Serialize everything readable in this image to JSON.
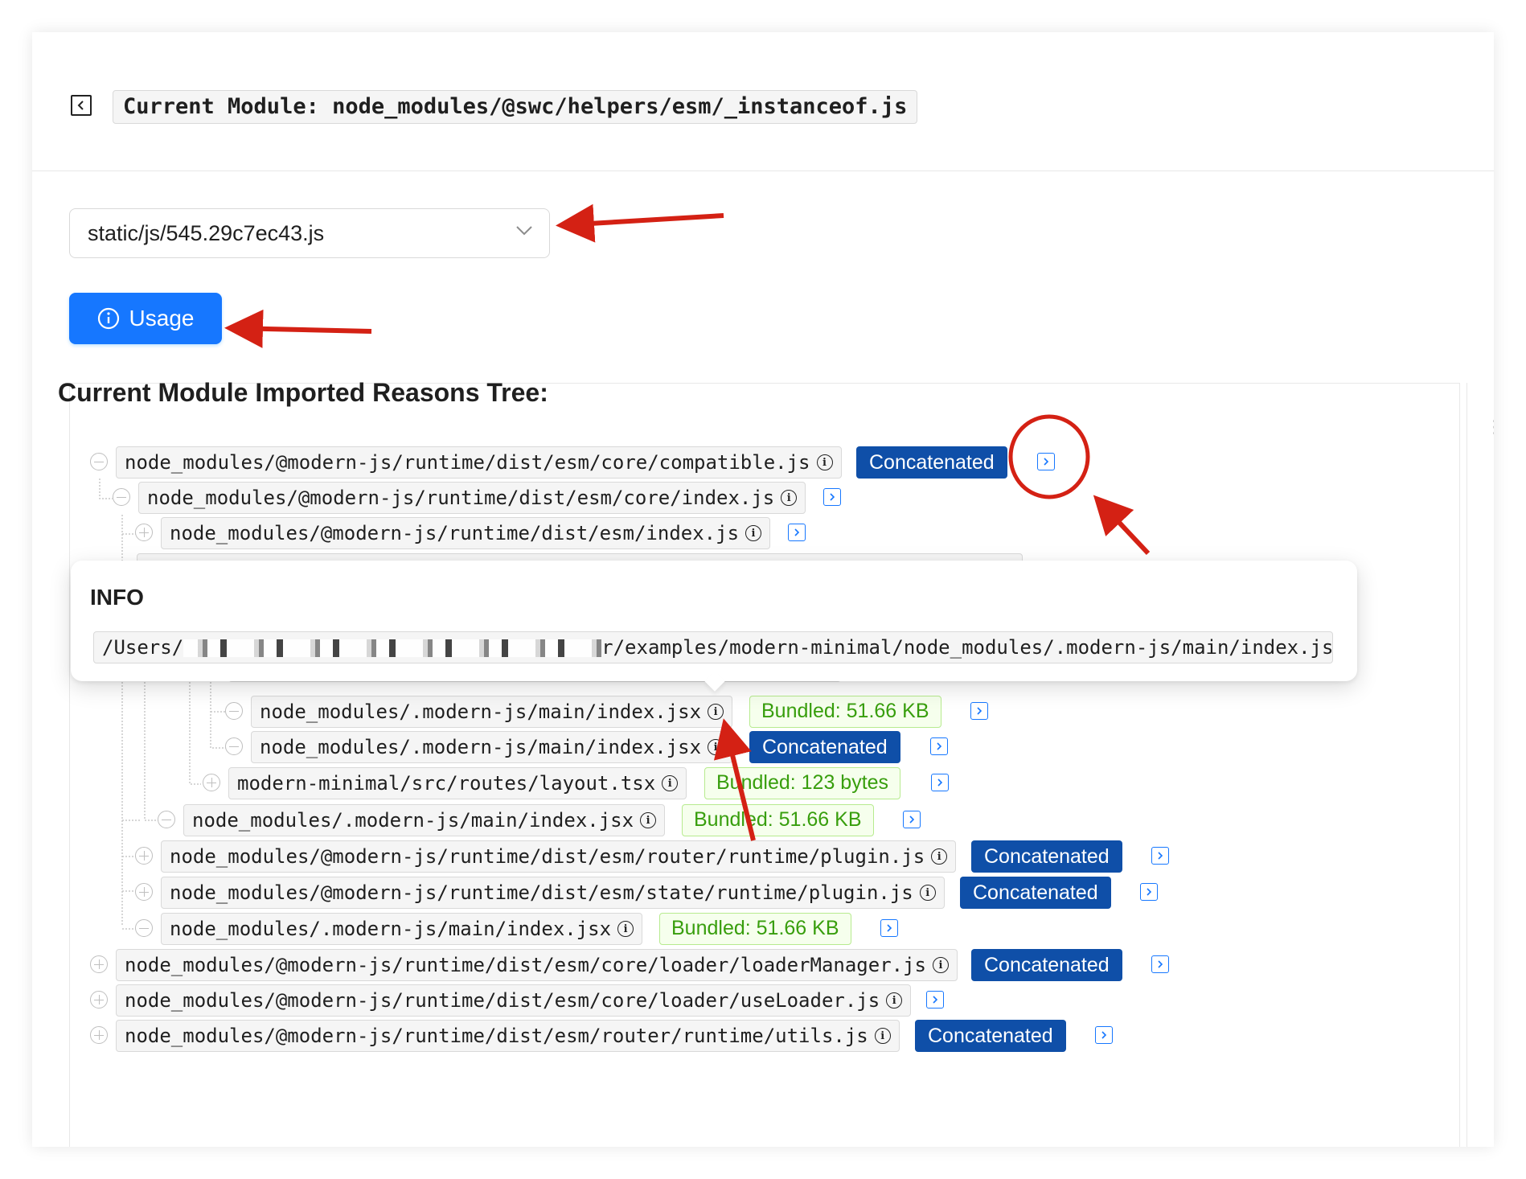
{
  "header": {
    "back_icon": "collapse-left-icon",
    "module_title": "Current Module: node_modules/@swc/helpers/esm/_instanceof.js"
  },
  "chunk_select": {
    "value": "static/js/545.29c7ec43.js",
    "icon": "chevron-down-icon"
  },
  "usage_button": {
    "label": "Usage",
    "icon": "info-circle-icon",
    "color": "#1677ff"
  },
  "tree": {
    "title": "Current Module Imported Reasons Tree:",
    "nodes": [
      {
        "path": "node_modules/@modern-js/runtime/dist/esm/core/compatible.js",
        "tag": "Concatenated",
        "toggle": "minus"
      },
      {
        "path": "node_modules/@modern-js/runtime/dist/esm/core/index.js",
        "tag": "",
        "toggle": "minus"
      },
      {
        "path": "node_modules/@modern-js/runtime/dist/esm/index.js",
        "tag": "",
        "toggle": "plus"
      },
      {
        "path": "node_modules/.modern-js/main/index.jsx",
        "tag": "Bundled: 51.66 KB",
        "toggle": "minus"
      },
      {
        "path": "node_modules/.modern-js/main/index.jsx",
        "tag": "Concatenated",
        "toggle": "minus"
      },
      {
        "path": "modern-minimal/src/routes/layout.tsx",
        "tag": "Bundled: 123 bytes",
        "toggle": "plus"
      },
      {
        "path": "node_modules/.modern-js/main/index.jsx",
        "tag": "Bundled: 51.66 KB",
        "toggle": "minus"
      },
      {
        "path": "node_modules/@modern-js/runtime/dist/esm/router/runtime/plugin.js",
        "tag": "Concatenated",
        "toggle": "plus"
      },
      {
        "path": "node_modules/@modern-js/runtime/dist/esm/state/runtime/plugin.js",
        "tag": "Concatenated",
        "toggle": "plus"
      },
      {
        "path": "node_modules/.modern-js/main/index.jsx",
        "tag": "Bundled: 51.66 KB",
        "toggle": "minus"
      },
      {
        "path": "node_modules/@modern-js/runtime/dist/esm/core/loader/loaderManager.js",
        "tag": "Concatenated",
        "toggle": "plus"
      },
      {
        "path": "node_modules/@modern-js/runtime/dist/esm/core/loader/useLoader.js",
        "tag": "",
        "toggle": "plus"
      },
      {
        "path": "node_modules/@modern-js/runtime/dist/esm/router/runtime/utils.js",
        "tag": "Concatenated",
        "toggle": "plus"
      }
    ]
  },
  "popover": {
    "title": "INFO",
    "path_prefix": "/Users/",
    "path_suffix": "r/examples/modern-minimal/node_modules/.modern-js/main/index.jsx"
  },
  "colors": {
    "concatenated_tag": "#0f4fa8",
    "bundled_tag_text": "#389e0d",
    "bundled_tag_bg": "#f6ffed",
    "jump_icon": "#1677ff",
    "annotation_red": "#d42114"
  }
}
